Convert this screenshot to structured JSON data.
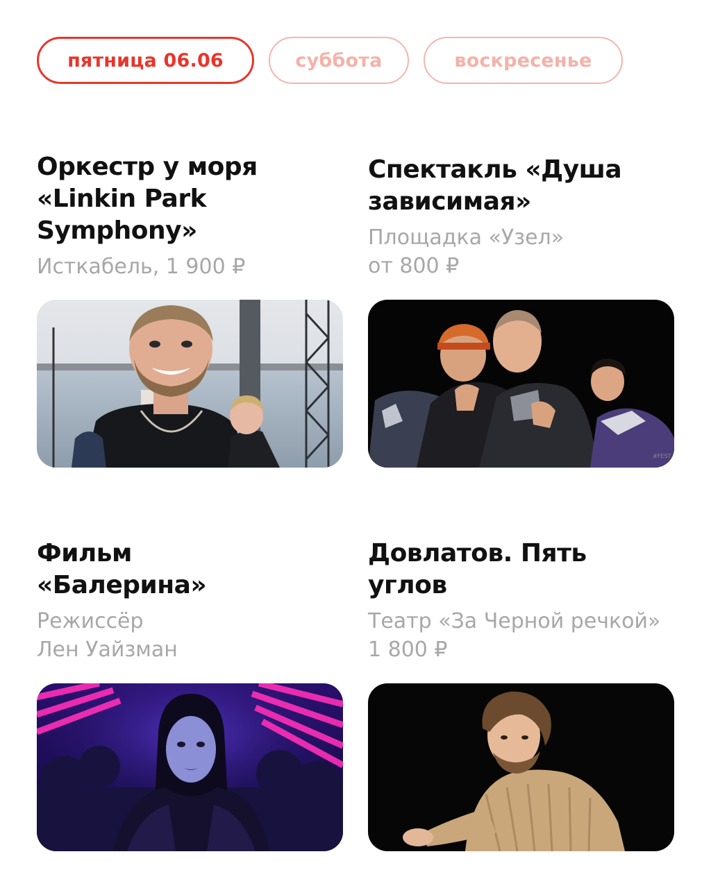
{
  "tabs": [
    {
      "label": "пятница 06.06",
      "active": true
    },
    {
      "label": "суббота",
      "active": false
    },
    {
      "label": "воскресенье",
      "active": false
    }
  ],
  "events": [
    {
      "title_lines": [
        "Оркестр у моря",
        "«Linkin Park",
        "Symphony»"
      ],
      "meta_lines": [
        "Исткабель, 1 900 ₽"
      ],
      "image": "orchestra-performer-photo"
    },
    {
      "title_lines": [
        "Спектакль «Душа",
        "зависимая»"
      ],
      "meta_lines": [
        "Площадка «Узел»",
        "от 800 ₽"
      ],
      "image": "theatre-actors-photo"
    },
    {
      "title_lines": [
        "Фильм",
        "«Балерина»"
      ],
      "meta_lines": [
        "Режиссёр",
        "Лен Уайзман"
      ],
      "image": "film-still-neon-photo"
    },
    {
      "title_lines": [
        "Довлатов. Пять",
        "углов"
      ],
      "meta_lines": [
        "Театр «За Черной речкой»",
        "1 800 ₽"
      ],
      "image": "actor-sweater-photo"
    }
  ],
  "colors": {
    "accent": "#e8352b",
    "accent_light": "#f4b2a9",
    "text": "#111111",
    "muted": "#a7a7a7"
  }
}
